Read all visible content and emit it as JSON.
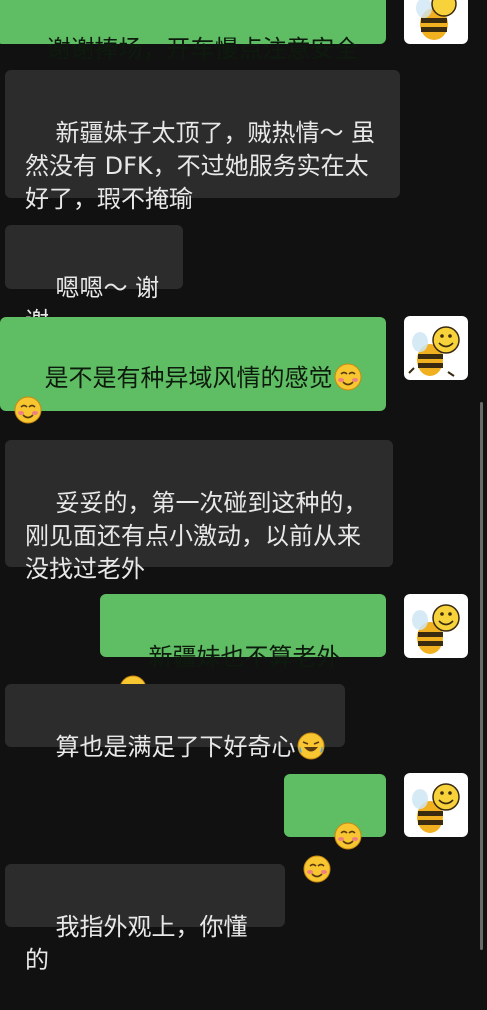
{
  "messages": [
    {
      "side": "out",
      "text": "谢谢捧场，开车慢点注意安全",
      "emoji": []
    },
    {
      "side": "in",
      "text": "新疆妹子太顶了，贼热情～ 虽然没有 DFK，不过她服务实在太好了，瑕不掩瑜",
      "emoji": []
    },
    {
      "side": "in",
      "text": "嗯嗯～ 谢谢",
      "emoji": []
    },
    {
      "side": "out",
      "text": "是不是有种异域风情的感觉",
      "emoji": [
        "blush-emoji",
        "blush-emoji"
      ]
    },
    {
      "side": "in",
      "text": "妥妥的，第一次碰到这种的，刚见面还有点小激动，以前从来没找过老外",
      "emoji": []
    },
    {
      "side": "out",
      "text": "新疆妹也不算老外",
      "emoji": [
        "laugh-cry-emoji"
      ]
    },
    {
      "side": "in",
      "text": "算也是满足了下好奇心",
      "emoji": [
        "laugh-cry-emoji"
      ]
    },
    {
      "side": "out",
      "text": "",
      "emoji": [
        "blush-emoji",
        "blush-emoji"
      ]
    },
    {
      "side": "in",
      "text": "我指外观上，你懂的",
      "emoji": []
    }
  ],
  "avatar_icon": "bee-icon",
  "colors": {
    "incoming_bubble": "#2c2c2c",
    "outgoing_bubble": "#5fbe63",
    "background": "#111111"
  }
}
